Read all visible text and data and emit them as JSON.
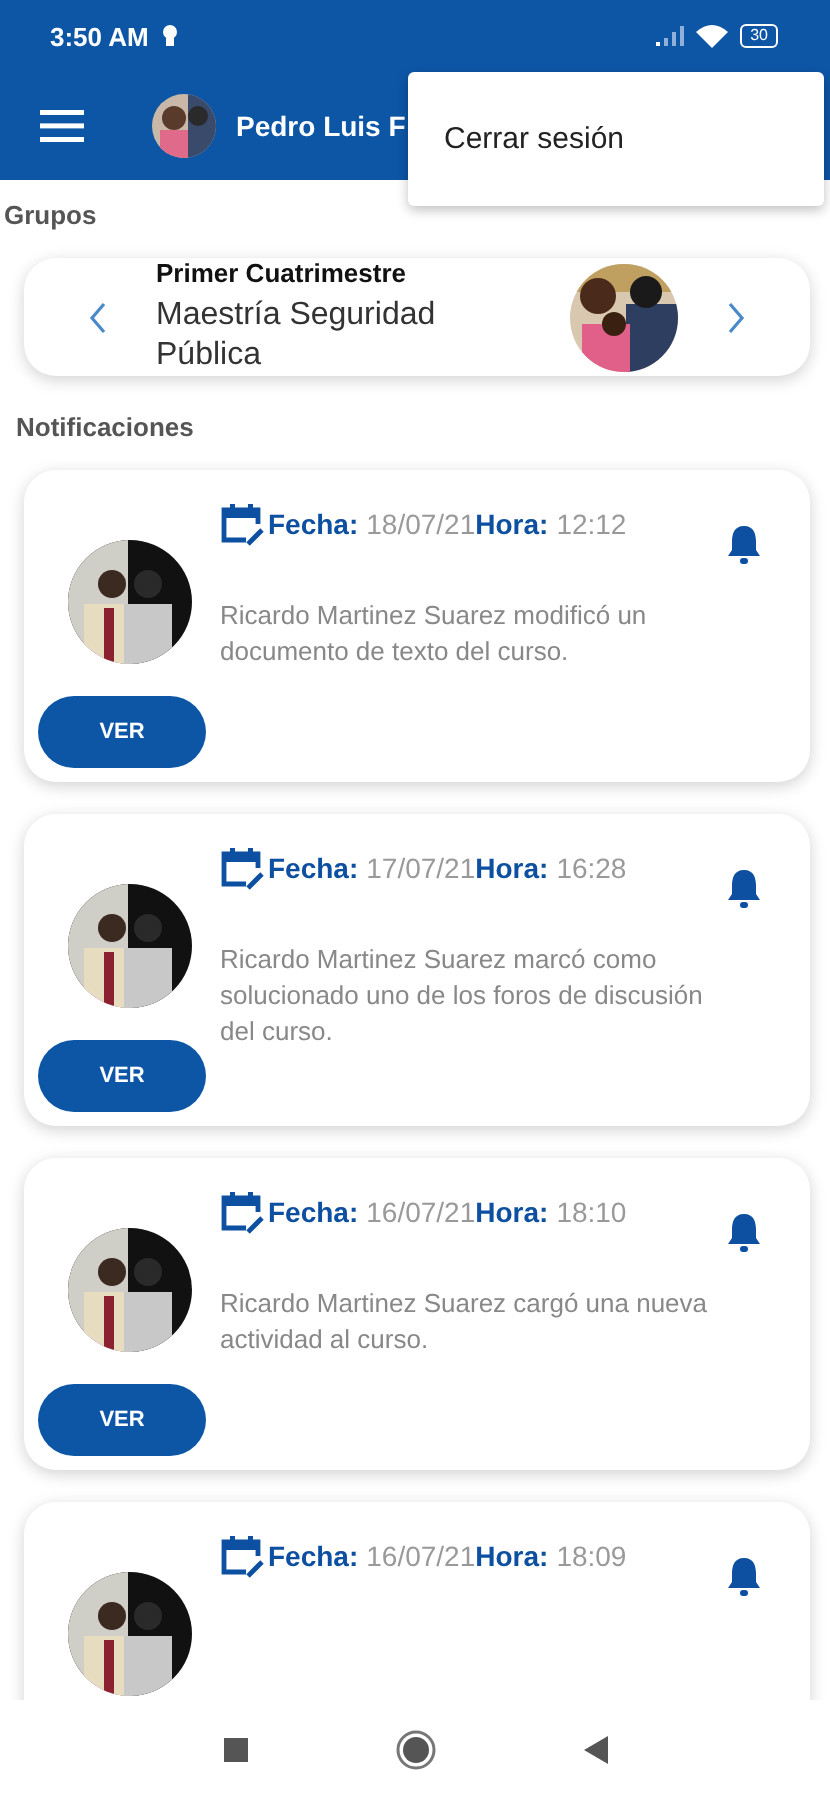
{
  "status_bar": {
    "time": "3:50 AM",
    "battery": "30"
  },
  "app_bar": {
    "user_name": "Pedro Luis F"
  },
  "menu": {
    "items": [
      "Cerrar sesión"
    ]
  },
  "groups": {
    "title": "Grupos",
    "card": {
      "period": "Primer Cuatrimestre",
      "name": "Maestría Seguridad Pública"
    }
  },
  "notifications": {
    "title": "Notificaciones",
    "items": [
      {
        "date_label": "Fecha:",
        "date": "18/07/21",
        "time_label": "Hora:",
        "time": "12:12",
        "message": "Ricardo Martinez Suarez modificó un documento de texto del curso.",
        "button": "VER"
      },
      {
        "date_label": "Fecha:",
        "date": "17/07/21",
        "time_label": "Hora:",
        "time": "16:28",
        "message": "Ricardo Martinez Suarez marcó como solucionado uno de los foros de discusión del curso.",
        "button": "VER"
      },
      {
        "date_label": "Fecha:",
        "date": "16/07/21",
        "time_label": "Hora:",
        "time": "18:10",
        "message": "Ricardo Martinez Suarez cargó una nueva actividad al curso.",
        "button": "VER"
      },
      {
        "date_label": "Fecha:",
        "date": "16/07/21",
        "time_label": "Hora:",
        "time": "18:09"
      }
    ]
  }
}
